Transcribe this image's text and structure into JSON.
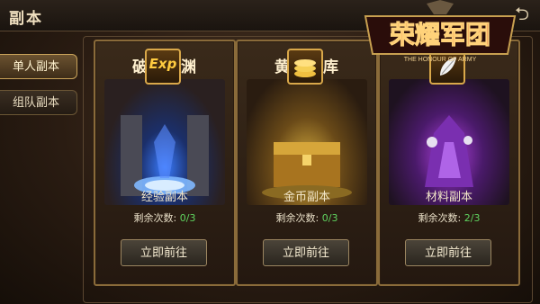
{
  "header": {
    "title": "副本",
    "back_icon": "back-arrow-icon"
  },
  "tabs": [
    {
      "label": "单人副本",
      "active": true
    },
    {
      "label": "组队副本",
      "active": false
    }
  ],
  "logo": {
    "text": "荣耀军团",
    "tagline": "THE HONOUR OF ARMY"
  },
  "cards": [
    {
      "title": "破碎深渊",
      "icon": "exp-icon",
      "icon_text": "Exp",
      "subtitle": "经验副本",
      "count_label": "剩余次数:",
      "count_value": "0/3",
      "button": "立即前往"
    },
    {
      "title": "黄金宝库",
      "icon": "gold-coins-icon",
      "subtitle": "金币副本",
      "count_label": "剩余次数:",
      "count_value": "0/3",
      "button": "立即前往"
    },
    {
      "title": "",
      "icon": "white-feather-icon",
      "subtitle": "材料副本",
      "count_label": "剩余次数:",
      "count_value": "2/3",
      "button": "立即前往"
    }
  ],
  "colors": {
    "count_value": "#5fd35f",
    "frame_gold": "#8a6b3a",
    "logo_red": "#c81a10"
  }
}
